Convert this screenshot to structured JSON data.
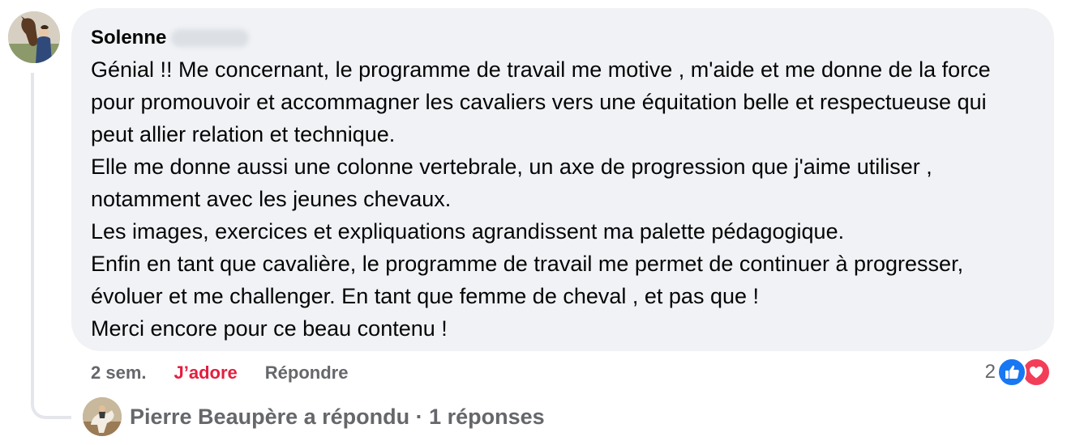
{
  "comment": {
    "author_name": "Solenne",
    "paragraphs": [
      "Génial !! Me concernant, le programme de travail me motive , m'aide et me donne de la force pour promouvoir et accommagner les cavaliers vers une équitation belle et respectueuse qui peut allier relation et technique.",
      "Elle me donne aussi une colonne vertebrale, un axe de progression que j'aime utiliser , notamment avec les jeunes chevaux.",
      "Les images, exercices et expliquations agrandissent ma palette pédagogique.",
      "Enfin en tant que cavalière, le programme de travail me permet de continuer à progresser, évoluer et me challenger. En tant que femme de cheval , et pas que !",
      "Merci encore pour ce beau contenu !"
    ]
  },
  "actions": {
    "time": "2 sem.",
    "like_label": "J’adore",
    "reply_label": "Répondre"
  },
  "reactions": {
    "count": "2",
    "icons": [
      "like-icon",
      "love-icon"
    ],
    "like_color": "#1877f2",
    "love_color": "#f33e58"
  },
  "replies": {
    "summary": "Pierre Beaupère a répondu · 1 réponses"
  },
  "colors": {
    "bubble_bg": "#f0f2f5",
    "secondary_text": "#65676b",
    "like_active": "#e41e3f"
  }
}
